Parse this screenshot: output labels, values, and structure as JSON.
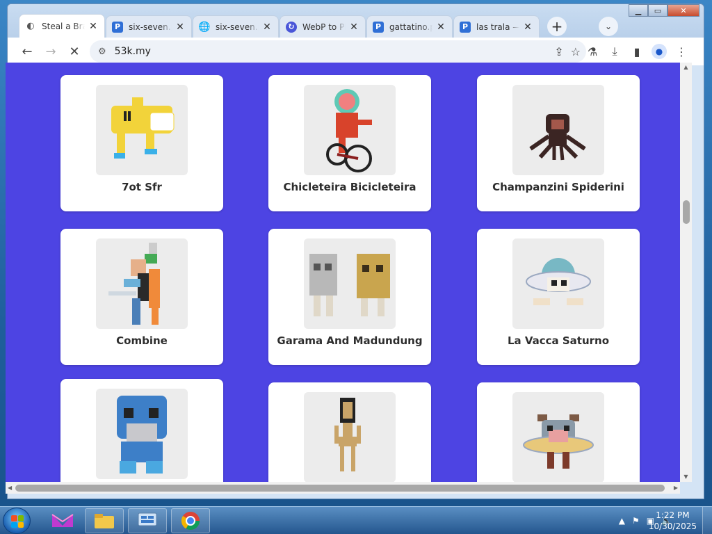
{
  "tabs": [
    {
      "title": "Steal a Brainrot",
      "icon": "loading-icon",
      "active": true
    },
    {
      "title": "six-seven.png",
      "icon": "p-icon"
    },
    {
      "title": "six-seven.png",
      "icon": "globe-icon"
    },
    {
      "title": "WebP to PNG",
      "icon": "webp-icon"
    },
    {
      "title": "gattatino.png",
      "icon": "p-icon"
    },
    {
      "title": "las trala — P",
      "icon": "p-icon"
    }
  ],
  "toolbar": {
    "url": "53k.my"
  },
  "cards": [
    {
      "name": "7ot Sfr",
      "color": "#f2d33a"
    },
    {
      "name": "Chicleteira Bicicleteira",
      "color": "#d8432b"
    },
    {
      "name": "Champanzini Spiderini",
      "color": "#3b2523"
    },
    {
      "name": "Combine",
      "color": "#7fb48b"
    },
    {
      "name": "Garama And Madundung",
      "color": "#c9a54e"
    },
    {
      "name": "La Vacca Saturno",
      "color": "#78b8c4"
    },
    {
      "name": "",
      "color": "#3d7fc8"
    },
    {
      "name": "",
      "color": "#c9a468"
    },
    {
      "name": "",
      "color": "#7c5a45"
    }
  ],
  "taskbar": {
    "time": "1:22 PM",
    "date": "10/30/2025"
  },
  "colors": {
    "page_background": "#4d44e3",
    "card_background": "#ffffff"
  }
}
